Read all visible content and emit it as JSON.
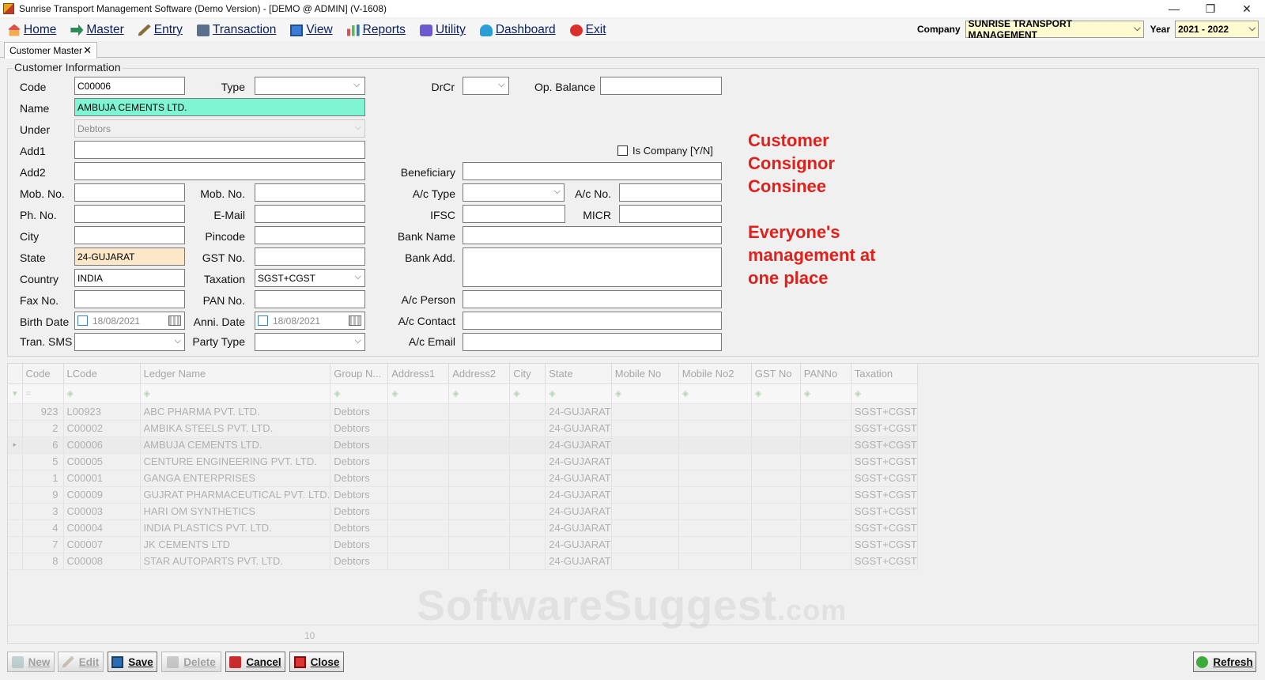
{
  "window": {
    "title": "Sunrise Transport Management Software (Demo Version) - [DEMO @ ADMIN] (V-1608)",
    "min": "—",
    "max": "❐",
    "close": "✕"
  },
  "menu": [
    {
      "label": "Home",
      "icon": "home-icon"
    },
    {
      "label": "Master",
      "icon": "master-icon"
    },
    {
      "label": "Entry",
      "icon": "pencil-icon"
    },
    {
      "label": "Transaction",
      "icon": "transaction-icon"
    },
    {
      "label": "View",
      "icon": "view-icon"
    },
    {
      "label": "Reports",
      "icon": "bar-chart-icon"
    },
    {
      "label": "Utility",
      "icon": "utility-icon"
    },
    {
      "label": "Dashboard",
      "icon": "dashboard-icon"
    },
    {
      "label": "Exit",
      "icon": "exit-icon"
    }
  ],
  "company": {
    "label": "Company",
    "value": "SUNRISE TRANSPORT MANAGEMENT"
  },
  "year": {
    "label": "Year",
    "value": "2021 - 2022"
  },
  "tab": {
    "label": "Customer Master",
    "close": "✕"
  },
  "form": {
    "group_title": "Customer Information",
    "labels": {
      "code": "Code",
      "type": "Type",
      "drcr": "DrCr",
      "op_balance": "Op. Balance",
      "name": "Name",
      "under": "Under",
      "add1": "Add1",
      "add2": "Add2",
      "mob1": "Mob. No.",
      "mob2": "Mob. No.",
      "phone": "Ph. No.",
      "email": "E-Mail",
      "city": "City",
      "pincode": "Pincode",
      "state": "State",
      "gst": "GST No.",
      "country": "Country",
      "taxation": "Taxation",
      "fax": "Fax No.",
      "pan": "PAN No.",
      "birth_date": "Birth Date",
      "anni_date": "Anni. Date",
      "tran_sms": "Tran. SMS",
      "party_type": "Party Type",
      "is_company": "Is Company [Y/N]",
      "beneficiary": "Beneficiary",
      "ac_type": "A/c Type",
      "ac_no": "A/c No.",
      "ifsc": "IFSC",
      "micr": "MICR",
      "bank_name": "Bank Name",
      "bank_add": "Bank Add.",
      "ac_person": "A/c Person",
      "ac_contact": "A/c Contact",
      "ac_email": "A/c Email"
    },
    "values": {
      "code": "C00006",
      "type": "",
      "drcr": "",
      "op_balance": "",
      "name": "AMBUJA CEMENTS LTD.",
      "under": "Debtors",
      "state": "24-GUJARAT",
      "country": "INDIA",
      "taxation": "SGST+CGST",
      "birth_date": "18/08/2021",
      "anni_date": "18/08/2021"
    }
  },
  "promo": {
    "lines1": [
      "Customer",
      "Consignor",
      "Consinee"
    ],
    "lines2": [
      "Everyone's",
      "management at",
      "one place"
    ]
  },
  "grid": {
    "columns": [
      "Code",
      "LCode",
      "Ledger Name",
      "Group N...",
      "Address1",
      "Address2",
      "City",
      "State",
      "Mobile No",
      "Mobile No2",
      "GST No",
      "PANNo",
      "Taxation"
    ],
    "rows": [
      [
        "923",
        "L00923",
        "ABC PHARMA PVT. LTD.",
        "Debtors",
        "",
        "",
        "",
        "24-GUJARAT",
        "",
        "",
        "",
        "",
        "SGST+CGST"
      ],
      [
        "2",
        "C00002",
        "AMBIKA STEELS PVT. LTD.",
        "Debtors",
        "",
        "",
        "",
        "24-GUJARAT",
        "",
        "",
        "",
        "",
        "SGST+CGST"
      ],
      [
        "6",
        "C00006",
        "AMBUJA CEMENTS LTD.",
        "Debtors",
        "",
        "",
        "",
        "24-GUJARAT",
        "",
        "",
        "",
        "",
        "SGST+CGST"
      ],
      [
        "5",
        "C00005",
        "CENTURE ENGINEERING PVT. LTD.",
        "Debtors",
        "",
        "",
        "",
        "24-GUJARAT",
        "",
        "",
        "",
        "",
        "SGST+CGST"
      ],
      [
        "1",
        "C00001",
        "GANGA ENTERPRISES",
        "Debtors",
        "",
        "",
        "",
        "24-GUJARAT",
        "",
        "",
        "",
        "",
        "SGST+CGST"
      ],
      [
        "9",
        "C00009",
        "GUJRAT PHARMACEUTICAL PVT. LTD.",
        "Debtors",
        "",
        "",
        "",
        "24-GUJARAT",
        "",
        "",
        "",
        "",
        "SGST+CGST"
      ],
      [
        "3",
        "C00003",
        "HARI OM SYNTHETICS",
        "Debtors",
        "",
        "",
        "",
        "24-GUJARAT",
        "",
        "",
        "",
        "",
        "SGST+CGST"
      ],
      [
        "4",
        "C00004",
        "INDIA PLASTICS PVT. LTD.",
        "Debtors",
        "",
        "",
        "",
        "24-GUJARAT",
        "",
        "",
        "",
        "",
        "SGST+CGST"
      ],
      [
        "7",
        "C00007",
        "JK CEMENTS LTD",
        "Debtors",
        "",
        "",
        "",
        "24-GUJARAT",
        "",
        "",
        "",
        "",
        "SGST+CGST"
      ],
      [
        "8",
        "C00008",
        "STAR AUTOPARTS PVT. LTD.",
        "Debtors",
        "",
        "",
        "",
        "24-GUJARAT",
        "",
        "",
        "",
        "",
        "SGST+CGST"
      ]
    ],
    "current_row": 2,
    "count": "10"
  },
  "watermark": {
    "main": "SoftwareSuggest",
    "suffix": ".com"
  },
  "buttons": {
    "new": "New",
    "edit": "Edit",
    "save": "Save",
    "delete": "Delete",
    "cancel": "Cancel",
    "close": "Close",
    "refresh": "Refresh"
  }
}
